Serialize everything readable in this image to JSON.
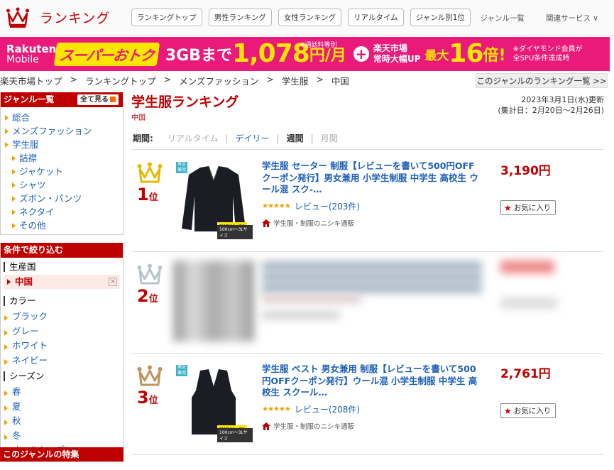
{
  "header": {
    "title": "ランキング",
    "tabs": [
      "ランキングトップ",
      "男性ランキング",
      "女性ランキング",
      "リアルタイム",
      "ジャンル別1位"
    ],
    "genre_list": "ジャンル一覧",
    "related": "関連サービス ∨"
  },
  "banner": {
    "brand_top": "Rakuten",
    "brand_bottom": "Mobile",
    "super": "スーパーおトク",
    "gb": "3GBまで",
    "price": "1,078",
    "unit": "円/月",
    "note": "※通話料等別",
    "market_1": "楽天市場",
    "market_2": "常時大幅UP",
    "max": "最大",
    "times": "16",
    "bai": "倍!",
    "dia_1": "※ダイヤモンド会員が",
    "dia_2": "全SPU条件達成時"
  },
  "breadcrumb": [
    "楽天市場トップ",
    "ランキングトップ",
    "メンズファッション",
    "学生服",
    "中国"
  ],
  "breadcrumb_sep": ">",
  "genre_ranking_list": "このジャンルのランキング一覧 >>",
  "sidebar": {
    "genre_head": "ジャンル一覧",
    "all_btn": "全て見る",
    "genres": [
      "総合",
      "メンズファッション",
      "学生服"
    ],
    "subgenres": [
      "詰襟",
      "ジャケット",
      "シャツ",
      "ズボン・パンツ",
      "ネクタイ",
      "その他"
    ],
    "cond_head": "条件で絞り込む",
    "origin_label": "生産国",
    "origin_selected": "中国",
    "color_label": "カラー",
    "colors": [
      "ブラック",
      "グレー",
      "ホワイト",
      "ネイビー"
    ],
    "season_label": "シーズン",
    "seasons": [
      "春",
      "夏",
      "秋",
      "冬",
      "オールシーズン"
    ],
    "feature_head": "このジャンルの特集"
  },
  "main": {
    "title": "学生服ランキング",
    "subtitle": "中国",
    "updated": "2023年3月1日(水)更新",
    "period_range": "(集計日：2月20日～2月26日)",
    "period_label": "期間:",
    "periods": [
      "リアルタイム",
      "デイリー",
      "週間",
      "月間"
    ]
  },
  "items": [
    {
      "rank": "1",
      "rank_unit": "位",
      "title": "学生服 セーター 制服【レビューを書いて500円OFFクーポン発行】男女兼用 小学生制服 中学生 高校生 ウール混 スク-…",
      "stars": "★★★★★",
      "review": "レビュー(203件)",
      "shop": "学生服・制服のニシキ通販",
      "price": "3,190円",
      "fav": "お気に入り",
      "tag_free": "送料無料",
      "tag_size": "100cm～3Lサイズ",
      "tag_gender": "男女兼用",
      "crown_color": "#e8b800"
    },
    {
      "rank": "2",
      "rank_unit": "位",
      "crown_color": "#b8c4cc"
    },
    {
      "rank": "3",
      "rank_unit": "位",
      "title": "学生服 ベスト 男女兼用 制服【レビューを書いて500円OFFクーポン発行】ウール混 小学生制服 中学生 高校生 スクール…",
      "stars": "★★★★★",
      "review": "レビュー(208件)",
      "shop": "学生服・制服のニシキ通販",
      "price": "2,761円",
      "fav": "お気に入り",
      "tag_free": "送料無料",
      "tag_size": "100cm～3Lサイズ",
      "tag_gender": "男女兼用",
      "crown_color": "#c0915a"
    }
  ]
}
